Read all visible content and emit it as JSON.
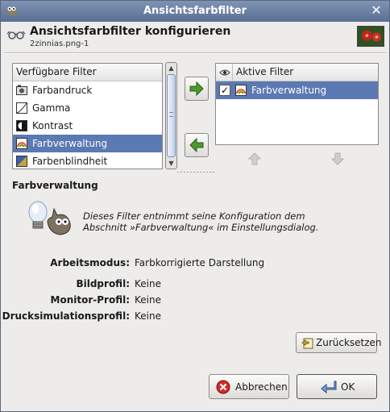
{
  "window": {
    "title": "Ansichtsfarbfilter"
  },
  "header": {
    "title": "Ansichtsfarbfilter konfigurieren",
    "subtitle": "2zinnias.png-1"
  },
  "available": {
    "header": "Verfügbare Filter",
    "items": [
      {
        "label": "Farbandruck",
        "icon": "camera-icon"
      },
      {
        "label": "Gamma",
        "icon": "curve-icon"
      },
      {
        "label": "Kontrast",
        "icon": "contrast-icon"
      },
      {
        "label": "Farbverwaltung",
        "icon": "rainbow-icon",
        "selected": true
      },
      {
        "label": "Farbenblindheit",
        "icon": "colorblind-icon"
      }
    ]
  },
  "active": {
    "header": "Aktive Filter",
    "items": [
      {
        "label": "Farbverwaltung",
        "checked": true,
        "icon": "rainbow-icon",
        "selected": true
      }
    ]
  },
  "detail": {
    "heading": "Farbverwaltung",
    "description_line1": "Dieses Filter entnimmt seine Konfiguration dem",
    "description_line2": "Abschnitt »Farbverwaltung« im Einstellungsdialog.",
    "fields": [
      {
        "label": "Arbeitsmodus:",
        "value": "Farbkorrigierte Darstellung"
      },
      {
        "label": "Bildprofil:",
        "value": "Keine"
      },
      {
        "label": "Monitor-Profil:",
        "value": "Keine"
      },
      {
        "label": "Drucksimulationsprofil:",
        "value": "Keine"
      }
    ]
  },
  "buttons": {
    "reset": "Zurücksetzen",
    "cancel": "Abbrechen",
    "ok": "OK"
  },
  "colors": {
    "selection": "#5b79b2",
    "arrow_green": "#4a9a2a"
  }
}
